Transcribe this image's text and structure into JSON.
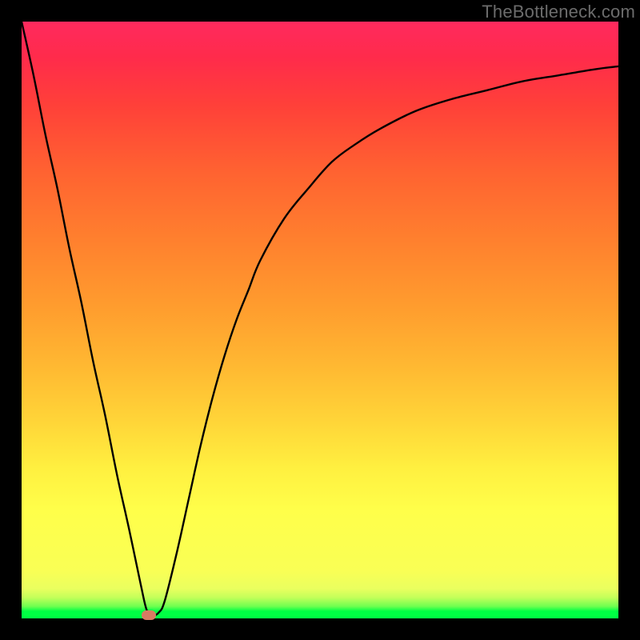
{
  "watermark": "TheBottleneck.com",
  "colors": {
    "frame": "#000000",
    "curve": "#000000",
    "marker": "#d87b62"
  },
  "chart_data": {
    "type": "line",
    "title": "",
    "xlabel": "",
    "ylabel": "",
    "xlim": [
      0,
      100
    ],
    "ylim": [
      0,
      100
    ],
    "grid": false,
    "legend": null,
    "series": [
      {
        "name": "bottleneck-curve",
        "x": [
          0,
          2,
          4,
          6,
          8,
          10,
          12,
          14,
          16,
          18,
          20,
          21,
          22,
          23,
          24,
          26,
          28,
          30,
          32,
          34,
          36,
          38,
          40,
          44,
          48,
          52,
          56,
          60,
          66,
          72,
          78,
          84,
          90,
          96,
          100
        ],
        "y": [
          100,
          91,
          81,
          72,
          62,
          53,
          43,
          34,
          24,
          15,
          5.5,
          1.3,
          0.5,
          1.0,
          3.0,
          11,
          20,
          29,
          37,
          44,
          50,
          55,
          60,
          67,
          72,
          76.5,
          79.5,
          82,
          85,
          87,
          88.5,
          90,
          91,
          92,
          92.5
        ]
      }
    ],
    "marker": {
      "x": 21.3,
      "y": 0.6
    },
    "background_gradient": {
      "direction": "bottom-to-top",
      "stops": [
        {
          "pos": 0.0,
          "color": "#00ff44"
        },
        {
          "pos": 0.03,
          "color": "#c3ff5a"
        },
        {
          "pos": 0.08,
          "color": "#f9ff55"
        },
        {
          "pos": 0.18,
          "color": "#ffff4a"
        },
        {
          "pos": 0.33,
          "color": "#ffd538"
        },
        {
          "pos": 0.52,
          "color": "#ff9d2e"
        },
        {
          "pos": 0.75,
          "color": "#ff6231"
        },
        {
          "pos": 0.94,
          "color": "#ff2b4b"
        },
        {
          "pos": 1.0,
          "color": "#ff2a5e"
        }
      ]
    }
  }
}
